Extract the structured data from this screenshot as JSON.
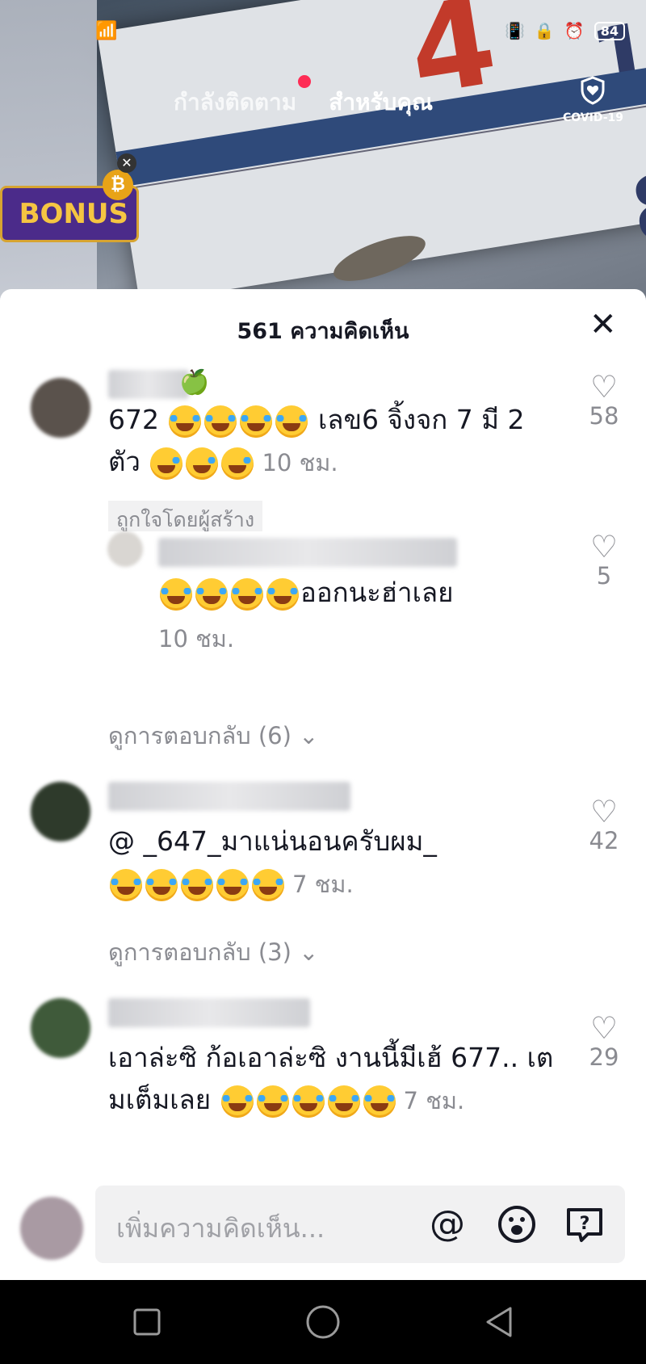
{
  "status_bar": {
    "battery": "84"
  },
  "top_nav": {
    "following": "กำลังติดตาม",
    "for_you": "สำหรับคุณ",
    "covid": "COVID-19"
  },
  "ad": {
    "banner_text": "BONUS",
    "coin": "₿"
  },
  "sheet": {
    "title": "561 ความคิดเห็น"
  },
  "comments": [
    {
      "text_a": "672 ",
      "text_b": " เลข6 จิ้งจก 7 มี 2 ตัว ",
      "time": "10 ชม.",
      "likes": "58",
      "badge": "ถูกใจโดยผู้สร้าง"
    },
    {
      "text": "ออกนะฮ่าเลย",
      "time": "10 ชม.",
      "likes": "5"
    },
    {
      "view_replies": "ดูการตอบกลับ (6)"
    },
    {
      "text_a": "@ ",
      "text_b": "_647_มาแน่นอนครับผม_",
      "time": "7 ชม.",
      "likes": "42"
    },
    {
      "view_replies": "ดูการตอบกลับ (3)"
    },
    {
      "text_a": "เอาล่ะซิ ก้อเอาล่ะซิ งานนี้มีเฮ้ 677.. เตมเต็มเลย ",
      "time": "7 ชม.",
      "likes": "29"
    }
  ],
  "input": {
    "placeholder": "เพิ่มความคิดเห็น..."
  }
}
